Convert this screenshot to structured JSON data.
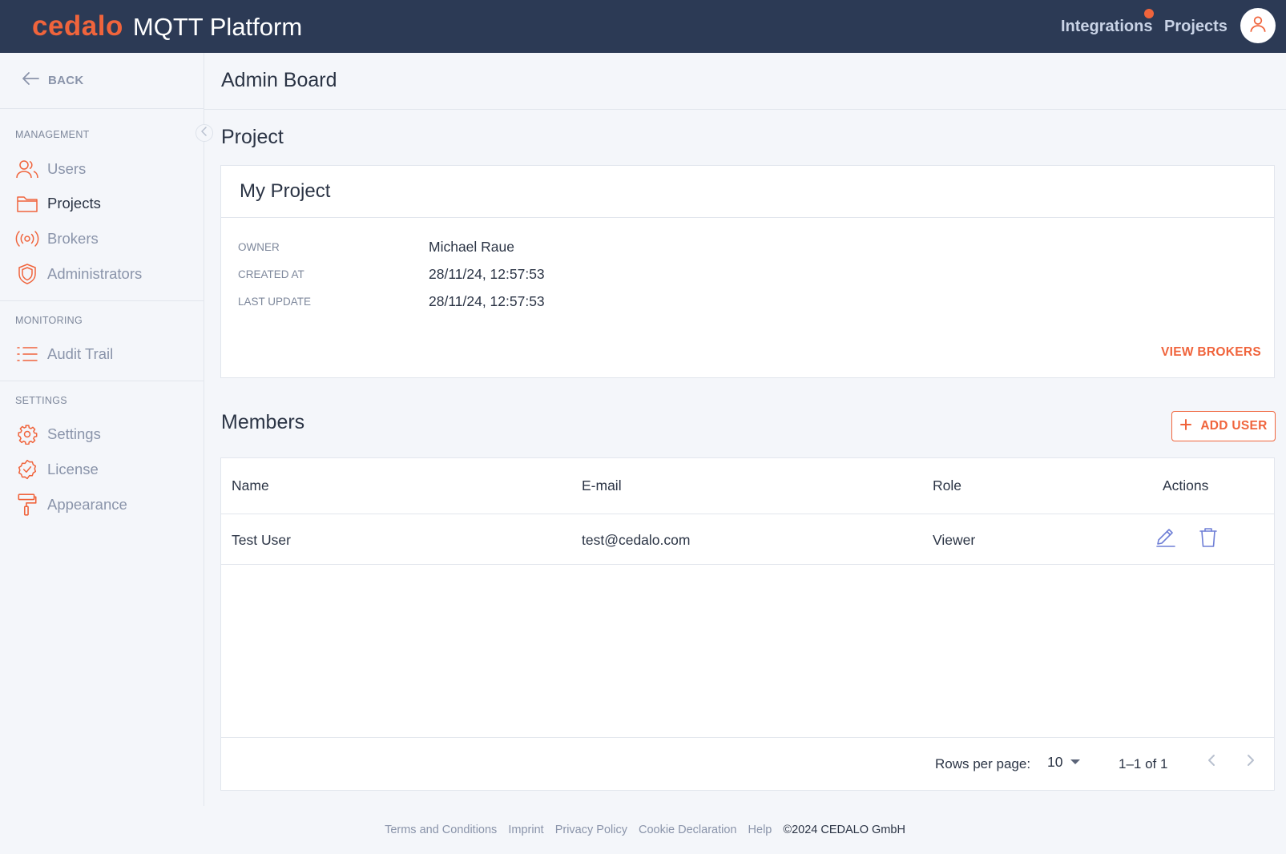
{
  "header": {
    "brand_logo": "cedalo",
    "brand_name": "MQTT Platform",
    "integrations": "Integrations",
    "projects": "Projects"
  },
  "sidebar": {
    "back": "BACK",
    "sections": {
      "management": "MANAGEMENT",
      "monitoring": "MONITORING",
      "settings": "SETTINGS"
    },
    "items": {
      "users": "Users",
      "projects": "Projects",
      "brokers": "Brokers",
      "administrators": "Administrators",
      "audit_trail": "Audit Trail",
      "settings": "Settings",
      "license": "License",
      "appearance": "Appearance"
    },
    "active_item": "Projects"
  },
  "main": {
    "page_title": "Admin Board",
    "project_section_title": "Project",
    "project": {
      "name": "My Project",
      "owner_label": "OWNER",
      "owner": "Michael Raue",
      "created_label": "CREATED AT",
      "created": "28/11/24, 12:57:53",
      "updated_label": "LAST UPDATE",
      "updated": "28/11/24, 12:57:53",
      "view_brokers": "VIEW BROKERS"
    },
    "members_title": "Members",
    "add_user": "ADD USER",
    "table": {
      "columns": [
        "Name",
        "E-mail",
        "Role",
        "Actions"
      ],
      "rows": [
        {
          "name": "Test User",
          "email": "test@cedalo.com",
          "role": "Viewer"
        }
      ]
    },
    "pagination": {
      "rows_per_page_label": "Rows per page:",
      "rows_per_page": "10",
      "range": "1–1 of 1"
    }
  },
  "footer": {
    "links": [
      "Terms and Conditions",
      "Imprint",
      "Privacy Policy",
      "Cookie Declaration",
      "Help"
    ],
    "copyright": "©2024 CEDALO GmbH"
  },
  "colors": {
    "accent": "#f0643c",
    "header_bg": "#2c3a55",
    "action_icon": "#6f7fd6",
    "page_bg": "#f4f6fa"
  },
  "icons": {
    "back": "arrow-left-icon",
    "collapse": "chevron-left-icon",
    "users": "users-icon",
    "projects": "folder-icon",
    "brokers": "broadcast-icon",
    "administrators": "shield-icon",
    "audit_trail": "list-icon",
    "settings": "gear-icon",
    "license": "badge-check-icon",
    "appearance": "paint-roller-icon",
    "edit": "pencil-icon",
    "delete": "trash-icon",
    "add": "plus-icon"
  }
}
